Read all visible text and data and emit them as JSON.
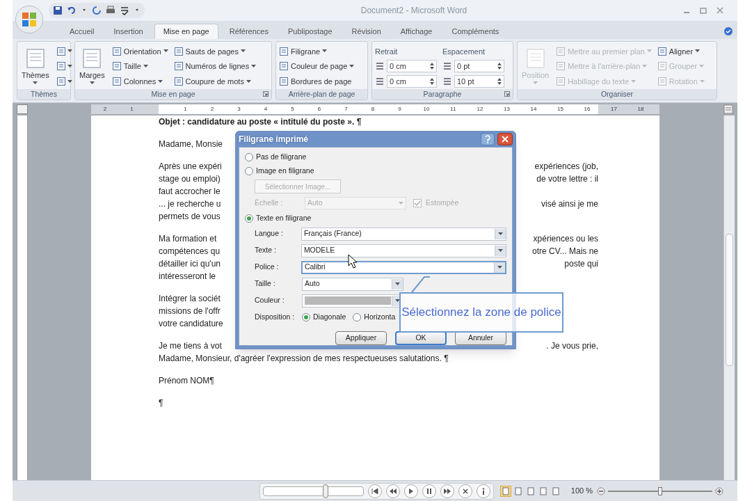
{
  "window": {
    "title": "Document2 - Microsoft Word"
  },
  "quick_access": [
    {
      "kind": "save"
    },
    {
      "kind": "undo"
    },
    {
      "kind": "dropdown"
    },
    {
      "kind": "redo"
    },
    {
      "kind": "print"
    },
    {
      "kind": "spell"
    },
    {
      "kind": "customize"
    }
  ],
  "tabs": [
    {
      "label": "Accueil",
      "selected": false
    },
    {
      "label": "Insertion",
      "selected": false
    },
    {
      "label": "Mise en page",
      "selected": true
    },
    {
      "label": "Références",
      "selected": false
    },
    {
      "label": "Publipostage",
      "selected": false
    },
    {
      "label": "Révision",
      "selected": false
    },
    {
      "label": "Affichage",
      "selected": false
    },
    {
      "label": "Compléments",
      "selected": false
    }
  ],
  "ribbon_groups": [
    {
      "label": "Thèmes",
      "launcher": false,
      "controls": [
        {
          "kind": "large",
          "label": "Thèmes",
          "disabled": false,
          "dropdown": true
        },
        {
          "kind": "icon",
          "disabled": false,
          "dropdown": true
        },
        {
          "kind": "icon",
          "disabled": false,
          "dropdown": true
        },
        {
          "kind": "icon",
          "disabled": false,
          "dropdown": true
        }
      ]
    },
    {
      "label": "Mise en page",
      "launcher": true,
      "controls": [
        {
          "kind": "large",
          "label": "Marges",
          "disabled": false,
          "dropdown": true
        },
        {
          "kind": "small",
          "label": "Orientation",
          "disabled": false,
          "dropdown": true
        },
        {
          "kind": "small",
          "label": "Taille",
          "disabled": false,
          "dropdown": true
        },
        {
          "kind": "small",
          "label": "Colonnes",
          "disabled": false,
          "dropdown": true
        },
        {
          "kind": "small",
          "label": "Sauts de pages",
          "disabled": false,
          "dropdown": true
        },
        {
          "kind": "small",
          "label": "Numéros de lignes",
          "disabled": false,
          "dropdown": true
        },
        {
          "kind": "small",
          "label": "Coupure de mots",
          "disabled": false,
          "dropdown": true
        }
      ]
    },
    {
      "label": "Arrière-plan de page",
      "launcher": false,
      "controls": [
        {
          "kind": "small",
          "label": "Filigrane",
          "disabled": false,
          "dropdown": true
        },
        {
          "kind": "small",
          "label": "Couleur de page",
          "disabled": false,
          "dropdown": true
        },
        {
          "kind": "small",
          "label": "Bordures de page",
          "disabled": false,
          "dropdown": false
        }
      ]
    },
    {
      "label": "Paragraphe",
      "launcher": true,
      "controls": [
        {
          "kind": "heading",
          "label": "Retrait",
          "disabled": false
        },
        {
          "kind": "spin",
          "label": "0 cm",
          "disabled": false
        },
        {
          "kind": "spin",
          "label": "0 cm",
          "disabled": false
        },
        {
          "kind": "heading",
          "label": "Espacement",
          "disabled": false
        },
        {
          "kind": "spin",
          "label": "0 pt",
          "disabled": false
        },
        {
          "kind": "spin",
          "label": "10 pt",
          "disabled": false
        }
      ]
    },
    {
      "label": "Organiser",
      "launcher": false,
      "controls": [
        {
          "kind": "large",
          "label": "Position",
          "disabled": true,
          "dropdown": true
        },
        {
          "kind": "small",
          "label": "Mettre au premier plan",
          "disabled": true,
          "dropdown": true
        },
        {
          "kind": "small",
          "label": "Mettre à l'arrière-plan",
          "disabled": true,
          "dropdown": true
        },
        {
          "kind": "small",
          "label": "Habillage du texte",
          "disabled": true,
          "dropdown": true
        },
        {
          "kind": "small",
          "label": "Aligner",
          "disabled": false,
          "dropdown": true
        },
        {
          "kind": "small",
          "label": "Grouper",
          "disabled": true,
          "dropdown": true
        },
        {
          "kind": "small",
          "label": "Rotation",
          "disabled": true,
          "dropdown": true
        }
      ]
    }
  ],
  "ruler": [
    "2",
    "1",
    "1",
    "2",
    "3",
    "4",
    "5",
    "6",
    "7",
    "8",
    "9",
    "10",
    "11",
    "12",
    "13",
    "14",
    "15",
    "16",
    "17",
    "18"
  ],
  "document": [
    {
      "bold": true,
      "lines": [
        {
          "left": "Objet : candidature au poste « intitulé du poste ». ¶"
        }
      ]
    },
    {
      "bold": false,
      "lines": [
        {
          "left": "Madame, Monsie"
        }
      ]
    },
    {
      "bold": false,
      "lines": [
        {
          "left": "Après une expéri",
          "right": "expériences (job,"
        },
        {
          "left": "stage ou emploi)",
          "right": "de votre lettre : il"
        },
        {
          "left": "faut accrocher le"
        },
        {
          "left": "... je recherche u",
          "right": "visé ainsi je me"
        },
        {
          "left": "permets de vous"
        }
      ]
    },
    {
      "bold": false,
      "lines": [
        {
          "left": "Ma formation et",
          "right": "xpériences ou les"
        },
        {
          "left": "compétences qu",
          "right": "otre CV... Mais ne"
        },
        {
          "left": "détailler ici qu'un",
          "right": "poste qui"
        },
        {
          "left": "intéresseront le"
        }
      ]
    },
    {
      "bold": false,
      "lines": [
        {
          "left": "Intégrer la sociét"
        },
        {
          "left": "missions de l'offr"
        },
        {
          "left": "votre candidature"
        }
      ]
    },
    {
      "bold": false,
      "lines": [
        {
          "left": "Je me tiens à vot",
          "right": ". Je vous prie,"
        },
        {
          "left": "Madame, Monsieur, d'agréer l'expression de mes respectueuses salutations. ¶"
        }
      ]
    },
    {
      "bold": false,
      "lines": [
        {
          "left": "Prénom NOM¶"
        }
      ]
    },
    {
      "bold": false,
      "lines": [
        {
          "left": "¶"
        }
      ]
    }
  ],
  "dialog": {
    "title": "Filigrane imprimé",
    "options": [
      {
        "label": "Pas de filigrane",
        "selected": false
      },
      {
        "label": "Image en filigrane",
        "selected": false
      },
      {
        "label": "Texte en filigrane",
        "selected": true
      }
    ],
    "image": {
      "button": "Sélectionner Image...",
      "scale_label": "Échelle :",
      "scale_value": "Auto",
      "washout_label": "Estompée",
      "washout_checked": true
    },
    "fields": [
      {
        "label": "Langue :",
        "value": "Français (France)",
        "kind": "dropdown",
        "focused": false
      },
      {
        "label": "Texte :",
        "value": "MODELE",
        "kind": "dropdown",
        "focused": false
      },
      {
        "label": "Police :",
        "value": "Calibri",
        "kind": "dropdown",
        "focused": true
      },
      {
        "label": "Taille :",
        "value": "Auto",
        "kind": "short",
        "focused": false
      },
      {
        "label": "Couleur :",
        "kind": "color",
        "focused": false
      }
    ],
    "layout_label": "Disposition :",
    "layout_options": [
      {
        "label": "Diagonale",
        "selected": true
      },
      {
        "label": "Horizonta",
        "selected": false
      }
    ],
    "buttons": [
      {
        "label": "Appliquer",
        "default": false
      },
      {
        "label": "OK",
        "default": true
      },
      {
        "label": "Annuler",
        "default": false
      }
    ]
  },
  "callout": {
    "text": "Sélectionnez la zone de police"
  },
  "player": {
    "level": 0.62,
    "controls": [
      {
        "kind": "first"
      },
      {
        "kind": "rewind"
      },
      {
        "kind": "play"
      },
      {
        "kind": "pause"
      },
      {
        "kind": "forward"
      },
      {
        "kind": "close"
      },
      {
        "kind": "info"
      }
    ]
  },
  "status_bar": {
    "views": [
      {
        "selected": true
      },
      {
        "selected": false
      },
      {
        "selected": false
      },
      {
        "selected": false
      },
      {
        "selected": false
      }
    ],
    "zoom": "100 %",
    "zoom_level": {
      "level": 0.5
    }
  }
}
